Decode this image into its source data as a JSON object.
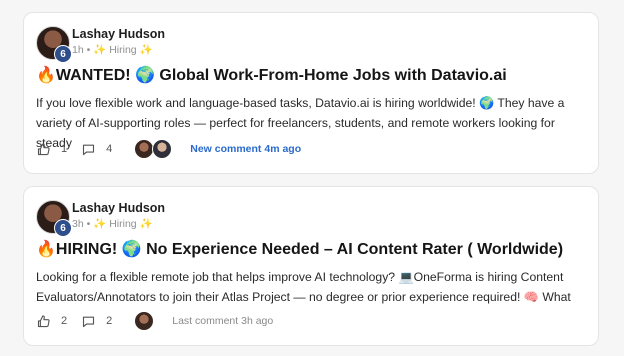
{
  "colors": {
    "accent_link": "#2a6acc",
    "level_badge": "#2e4e8c"
  },
  "posts": [
    {
      "author": "Lashay Hudson",
      "level": "6",
      "time": "1h",
      "separator": "•",
      "category": "✨ Hiring ✨",
      "title": "🔥WANTED! 🌍 Global Work-From-Home Jobs with Datavio.ai",
      "excerpt": "If you love flexible work and language-based tasks, Datavio.ai is hiring worldwide! 🌍 They have a variety of AI-supporting roles — perfect for freelancers, students, and remote workers looking for steady",
      "likes": "1",
      "comments": "4",
      "comment_status": "New comment 4m ago"
    },
    {
      "author": "Lashay Hudson",
      "level": "6",
      "time": "3h",
      "separator": "•",
      "category": "✨ Hiring ✨",
      "title": "🔥HIRING! 🌍 No Experience Needed – AI Content Rater ( Worldwide)",
      "excerpt": "Looking for a flexible remote job that helps improve AI technology? 💻OneForma is hiring Content Evaluators/Annotators to join their Atlas Project — no degree or prior experience required! 🧠 What",
      "likes": "2",
      "comments": "2",
      "comment_status": "Last comment 3h ago"
    }
  ]
}
